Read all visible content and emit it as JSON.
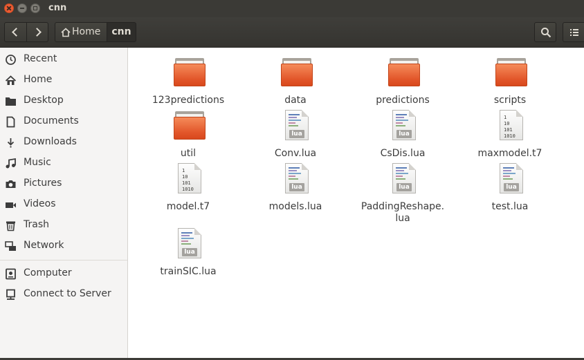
{
  "window": {
    "title": "cnn"
  },
  "header": {
    "breadcrumb": [
      {
        "label": "Home",
        "icon": "home-icon"
      },
      {
        "label": "cnn"
      }
    ]
  },
  "sidebar": {
    "items": [
      {
        "label": "Recent",
        "icon": "clock-icon"
      },
      {
        "label": "Home",
        "icon": "home-icon"
      },
      {
        "label": "Desktop",
        "icon": "folder-icon"
      },
      {
        "label": "Documents",
        "icon": "document-icon"
      },
      {
        "label": "Downloads",
        "icon": "download-icon"
      },
      {
        "label": "Music",
        "icon": "music-icon"
      },
      {
        "label": "Pictures",
        "icon": "camera-icon"
      },
      {
        "label": "Videos",
        "icon": "video-icon"
      },
      {
        "label": "Trash",
        "icon": "trash-icon"
      },
      {
        "label": "Network",
        "icon": "network-icon"
      },
      {
        "label": "Computer",
        "icon": "computer-icon"
      },
      {
        "label": "Connect to Server",
        "icon": "server-icon"
      }
    ]
  },
  "files": [
    {
      "name": "123predictions",
      "type": "folder"
    },
    {
      "name": "data",
      "type": "folder"
    },
    {
      "name": "predictions",
      "type": "folder"
    },
    {
      "name": "scripts",
      "type": "folder"
    },
    {
      "name": "util",
      "type": "folder"
    },
    {
      "name": "Conv.lua",
      "type": "lua",
      "badge": "lua"
    },
    {
      "name": "CsDis.lua",
      "type": "lua",
      "badge": "lua"
    },
    {
      "name": "maxmodel.t7",
      "type": "binary",
      "preview": "1\n10\n101\n1010"
    },
    {
      "name": "model.t7",
      "type": "binary",
      "preview": "1\n10\n101\n1010"
    },
    {
      "name": "models.lua",
      "type": "lua",
      "badge": "lua"
    },
    {
      "name": "PaddingReshape.\nlua",
      "type": "lua",
      "badge": "lua"
    },
    {
      "name": "test.lua",
      "type": "lua",
      "badge": "lua"
    },
    {
      "name": "trainSIC.lua",
      "type": "lua",
      "badge": "lua"
    }
  ],
  "colors": {
    "folder_orange": "#e2562a",
    "titlebar": "#3b3a36",
    "sidebar_bg": "#f5f4f3"
  }
}
